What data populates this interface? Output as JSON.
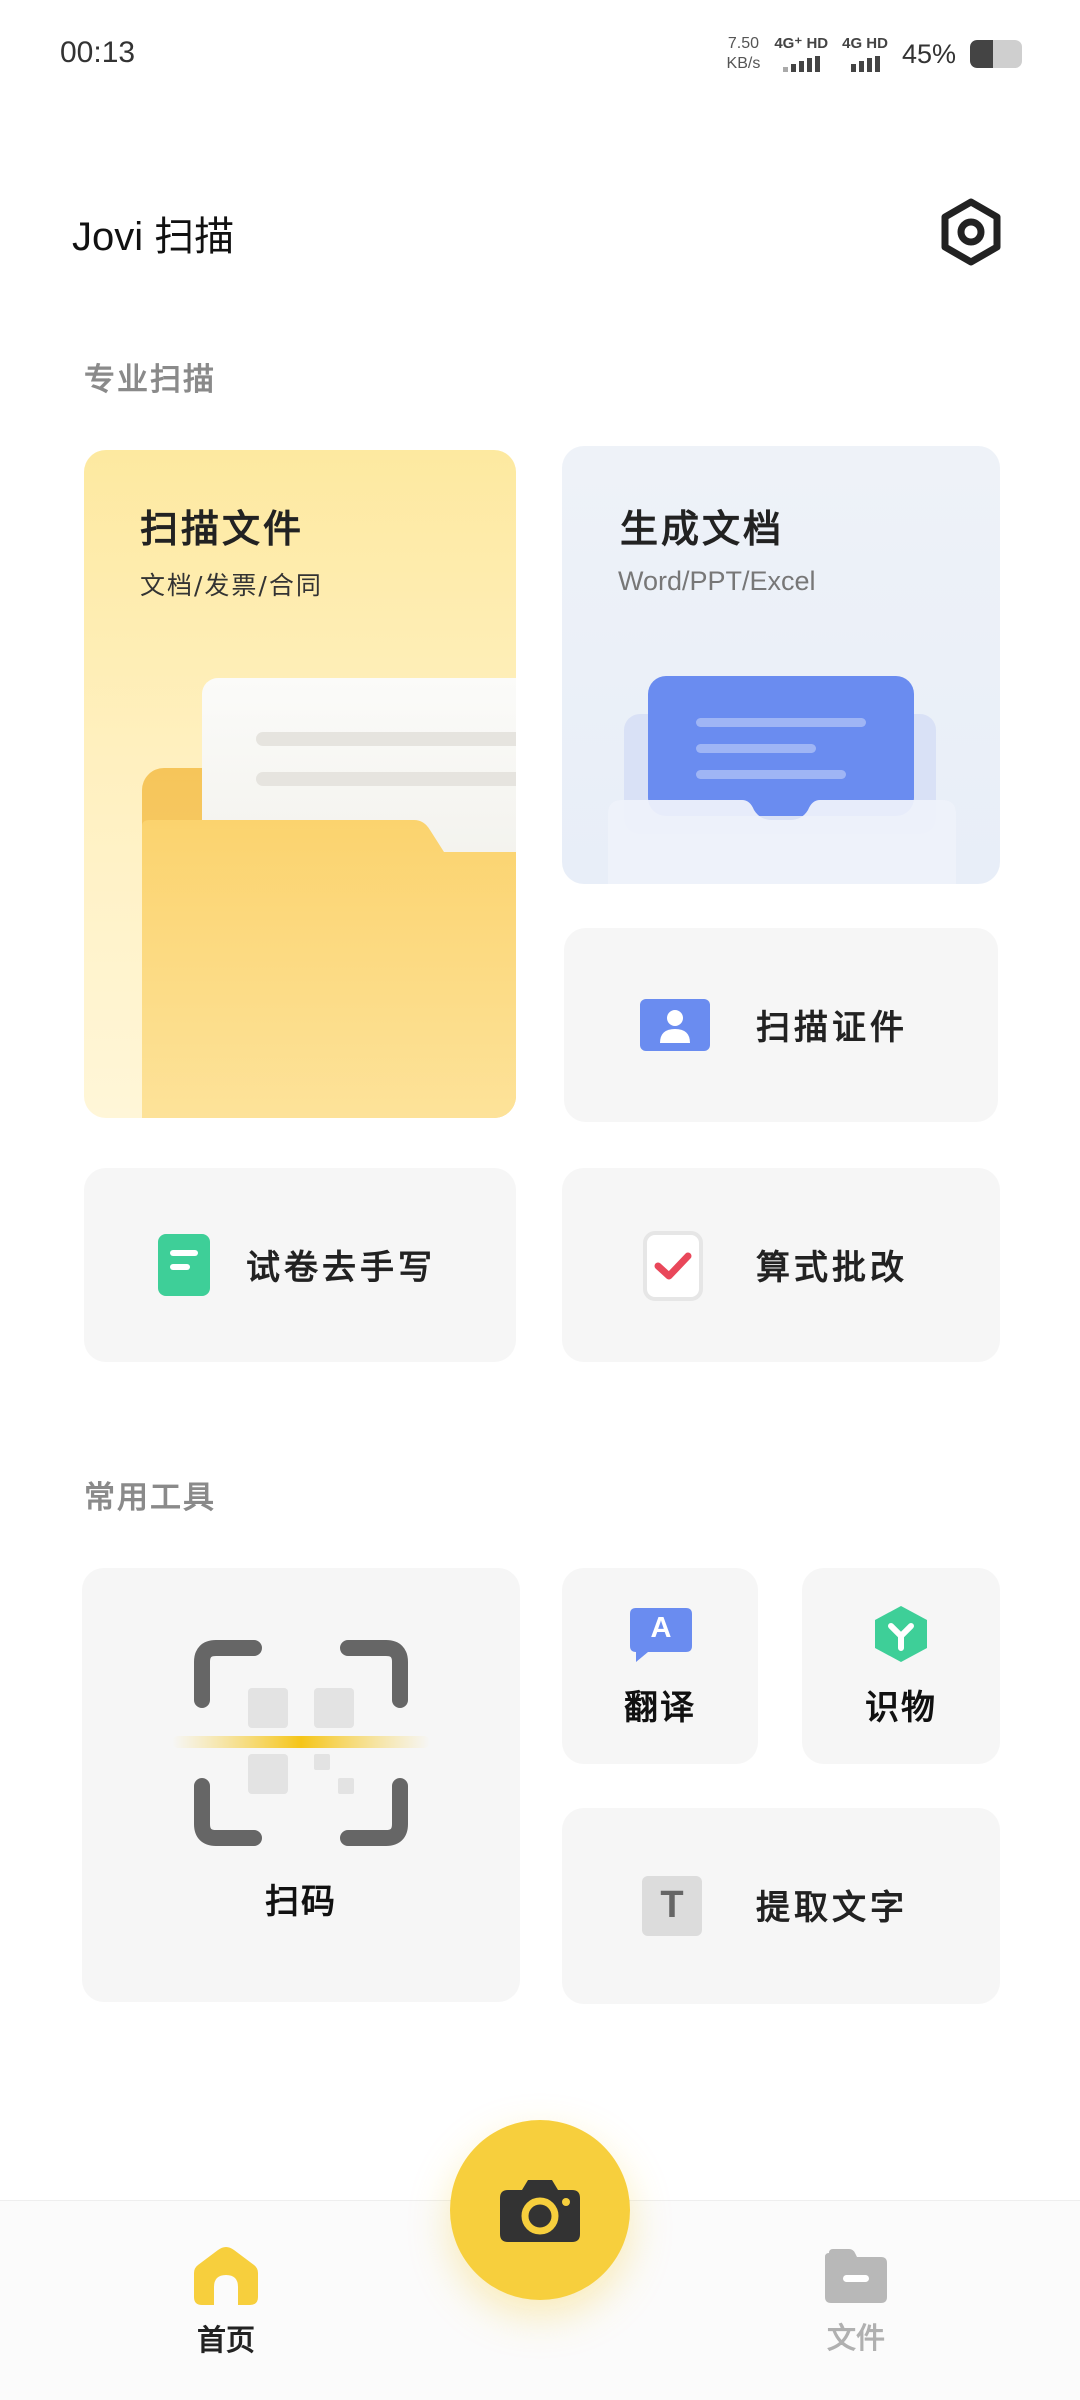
{
  "status": {
    "time": "00:13",
    "net_speed_value": "7.50",
    "net_speed_unit": "KB/s",
    "sim1": "4G⁺ HD",
    "sim2": "4G HD",
    "battery_percent": "45%",
    "battery_level": 0.45
  },
  "header": {
    "title": "Jovi 扫描",
    "settings_icon": "gear-hexagon-icon"
  },
  "sections": {
    "pro_scan": "专业扫描",
    "common_tools": "常用工具"
  },
  "pro_scan": {
    "scan_file": {
      "title": "扫描文件",
      "subtitle": "文档/发票/合同",
      "icon": "folder-document-illustration"
    },
    "generate_doc": {
      "title": "生成文档",
      "subtitle": "Word/PPT/Excel",
      "icon": "tray-document-illustration"
    },
    "scan_id": {
      "label": "扫描证件",
      "icon": "id-card-icon"
    },
    "exam_remove_handwriting": {
      "label": "试卷去手写",
      "icon": "green-document-icon"
    },
    "math_grading": {
      "label": "算式批改",
      "icon": "checkmark-clipboard-icon"
    }
  },
  "tools": {
    "scan_code": {
      "label": "扫码",
      "icon": "qr-scan-icon"
    },
    "translate": {
      "label": "翻译",
      "icon": "translate-bubble-icon",
      "glyph": "A"
    },
    "identify": {
      "label": "识物",
      "icon": "object-recognition-icon"
    },
    "extract_text": {
      "label": "提取文字",
      "icon": "text-t-icon",
      "glyph": "T"
    }
  },
  "bottom_nav": {
    "home": {
      "label": "首页",
      "icon": "home-icon"
    },
    "files": {
      "label": "文件",
      "icon": "folder-icon"
    },
    "camera": {
      "icon": "camera-icon"
    }
  },
  "colors": {
    "accent_yellow": "#f7cf3d",
    "blue": "#6a8cf0",
    "green": "#3ecf98",
    "red_check": "#e9475a",
    "muted_gray": "#8a8a8a"
  }
}
